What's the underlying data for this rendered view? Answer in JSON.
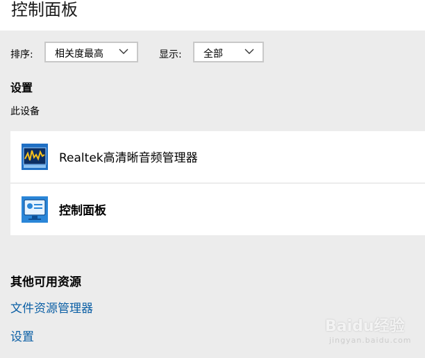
{
  "window": {
    "title": "控制面板"
  },
  "filters": {
    "sort_label": "排序:",
    "sort_value": "相关度最高",
    "show_label": "显示:",
    "show_value": "全部"
  },
  "settings_section": {
    "title": "设置",
    "subtitle": "此设备",
    "items": [
      {
        "label": "Realtek高清晰音频管理器",
        "icon": "realtek-audio-icon"
      },
      {
        "label": "控制面板",
        "icon": "control-panel-icon"
      }
    ]
  },
  "other_resources": {
    "title": "其他可用资源",
    "links": [
      "文件资源管理器",
      "设置"
    ]
  },
  "watermark": {
    "text": "Baidu经验",
    "sub": "jingyan.baidu.com"
  },
  "colors": {
    "accent": "#0b5fa5",
    "background": "#ececec",
    "card": "#ffffff"
  }
}
